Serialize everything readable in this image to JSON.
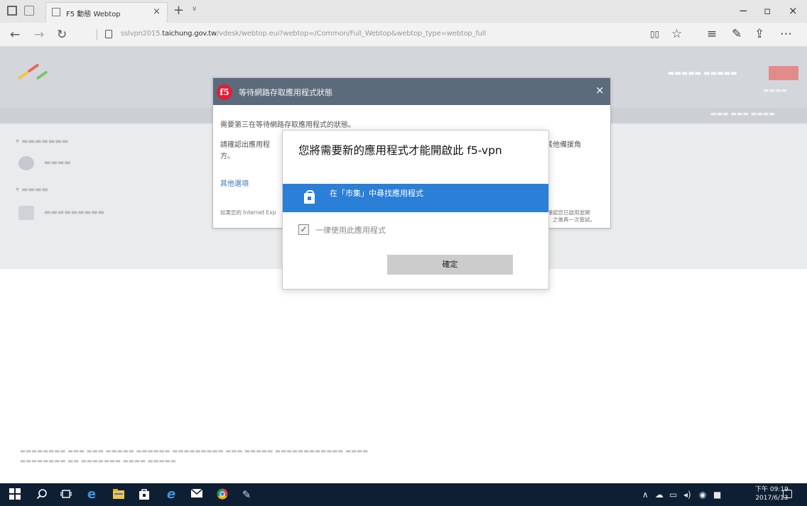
{
  "browser": {
    "tab_title": "F5 動態 Webtop",
    "tab_close": "×",
    "new_tab": "+",
    "tab_dropdown": "∨",
    "window_controls": {
      "minimize": "−",
      "maximize": "▫",
      "close": "×"
    },
    "nav": {
      "back": "←",
      "forward": "→",
      "refresh": "↻"
    },
    "url_prefix": "sslvpn2015.",
    "url_domain": "taichung.gov.tw",
    "url_rest": "/vdesk/webtop.eui?webtop=/Common/Full_Webtop&webtop_type=webtop_full",
    "toolbar_icons": {
      "reading_view": "▯▯",
      "favorite": "☆",
      "hub": "≡",
      "notes": "✎",
      "share": "⇪",
      "more": "⋯"
    }
  },
  "f5_dialog": {
    "title": "等待網路存取應用程式狀態",
    "close": "×",
    "line1": "需要第三在等待網路存取應用程式的狀態。",
    "line2_left": "請確認出應用程",
    "line2_right": "上的其他備援角",
    "line3": "方。",
    "link": "其他選項",
    "small_left": "如果您的 Internet Exp",
    "small_right_1": "或需要確認您已啟用並開",
    "small_right_2": "啟存取，之後再一次嘗試。"
  },
  "picker": {
    "title": "您將需要新的應用程式才能開啟此 f5-vpn",
    "store_option": "在「市集」中尋找應用程式",
    "checkbox_label": "一律使用此應用程式",
    "checkbox_mark": "✓",
    "ok_button": "確定"
  },
  "taskbar": {
    "time": "下午 09:19",
    "date": "2017/6/13",
    "tray_arrow": "∧"
  }
}
